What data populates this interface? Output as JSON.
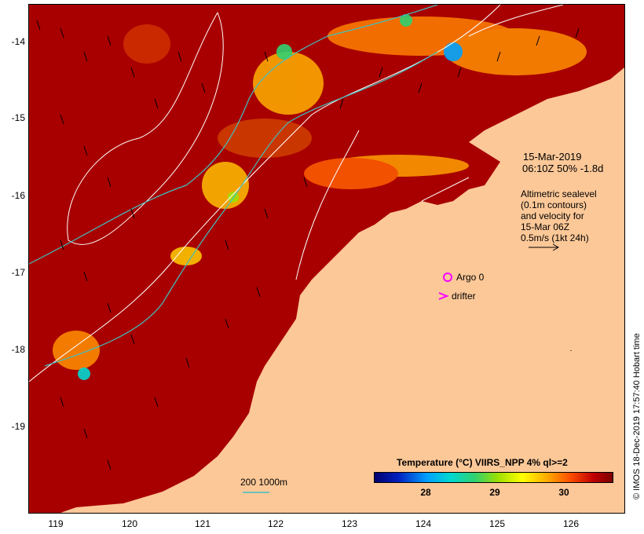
{
  "map": {
    "lat_ticks": [
      "-14",
      "-15",
      "-16",
      "-17",
      "-18",
      "-19"
    ],
    "lon_ticks": [
      "119",
      "120",
      "121",
      "122",
      "123",
      "124",
      "125",
      "126"
    ],
    "land_color": "#fcc898",
    "sea_color": "#a80000"
  },
  "annotation": {
    "date_line1": "15-Mar-2019",
    "date_line2": "06:10Z  50% -1.8d",
    "altimetry_lines": [
      "Altimetric sealevel",
      "(0.1m contours)",
      "and velocity for",
      "15-Mar 06Z",
      "0.5m/s (1kt 24h)"
    ]
  },
  "legend": {
    "argo_label": "Argo 0",
    "drifter_label": "drifter",
    "marker_color": "#ff00ff",
    "isobath_label": "200  1000m",
    "isobath_color": "#40c0c0"
  },
  "colorbar": {
    "title": "Temperature (°C) VIIRS_NPP 4% ql>=2",
    "ticks": [
      "28",
      "29",
      "30"
    ]
  },
  "credit": "© IMOS 18-Dec-2019 17:57:40 Hobart time"
}
